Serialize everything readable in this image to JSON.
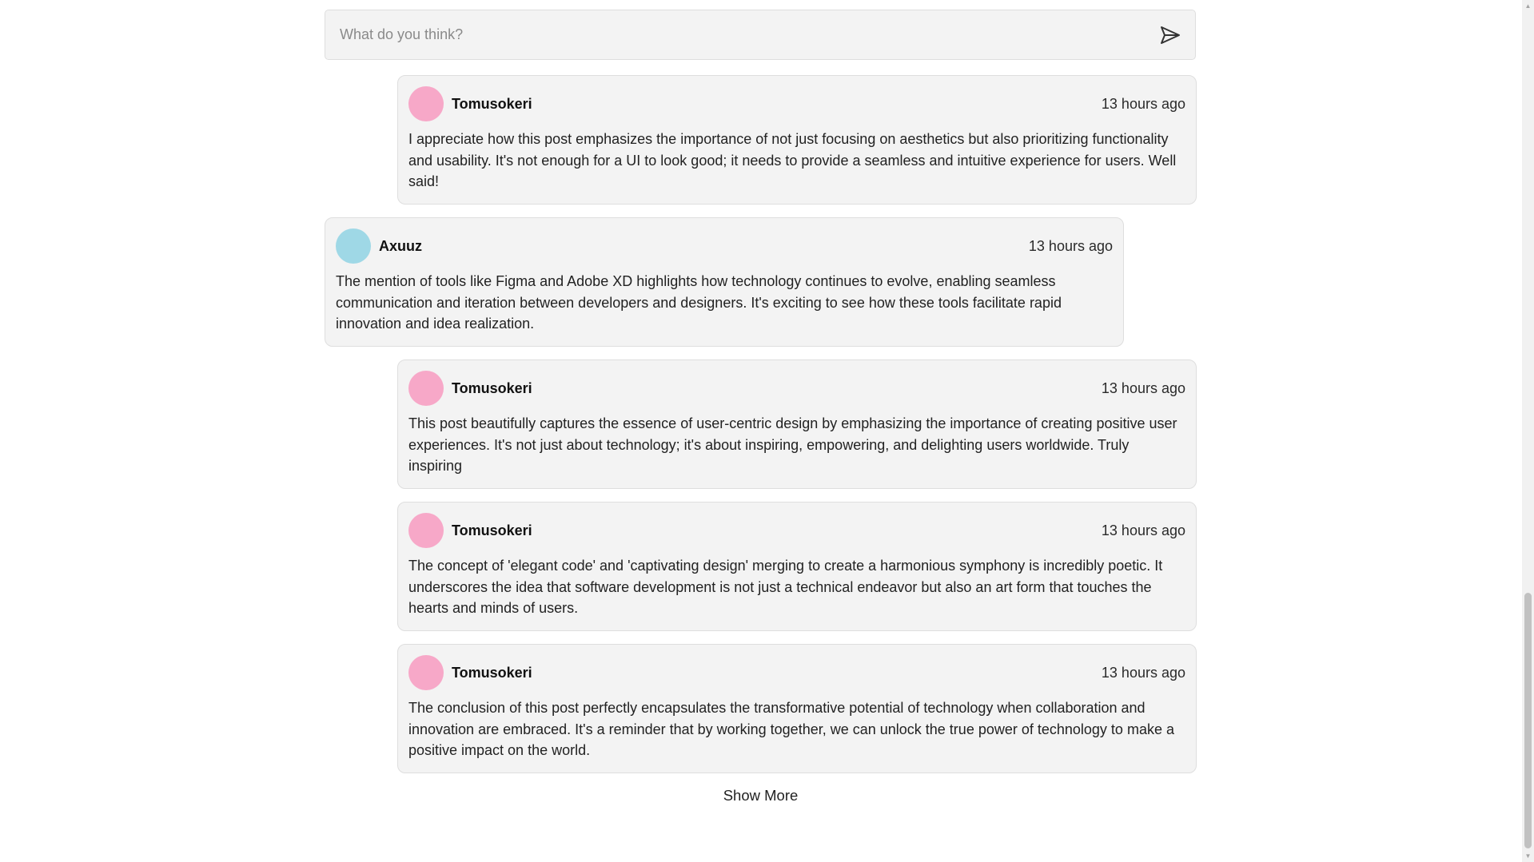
{
  "comment_box": {
    "placeholder": "What do you think?",
    "send_icon": "send-icon"
  },
  "comments": [
    {
      "author": "Tomusokeri",
      "time": "13 hours ago",
      "avatar_color": "#f7a8c8",
      "text": "I appreciate how this post emphasizes the importance of not just focusing on aesthetics but also prioritizing functionality and usability. It's not enough for a UI to look good; it needs to provide a seamless and intuitive experience for users. Well said!"
    },
    {
      "author": "Axuuz",
      "time": "13 hours ago",
      "avatar_color": "#9fd8e6",
      "text": "The mention of tools like Figma and Adobe XD highlights how technology continues to evolve, enabling seamless communication and iteration between developers and designers. It's exciting to see how these tools facilitate rapid innovation and idea realization."
    },
    {
      "author": "Tomusokeri",
      "time": "13 hours ago",
      "avatar_color": "#f7a8c8",
      "text": "This post beautifully captures the essence of user-centric design by emphasizing the importance of creating positive user experiences. It's not just about technology; it's about inspiring, empowering, and delighting users worldwide. Truly inspiring"
    },
    {
      "author": "Tomusokeri",
      "time": "13 hours ago",
      "avatar_color": "#f7a8c8",
      "text": "The concept of 'elegant code' and 'captivating design' merging to create a harmonious symphony is incredibly poetic. It underscores the idea that software development is not just a technical endeavor but also an art form that touches the hearts and minds of users."
    },
    {
      "author": "Tomusokeri",
      "time": "13 hours ago",
      "avatar_color": "#f7a8c8",
      "text": "The conclusion of this post perfectly encapsulates the transformative potential of technology when collaboration and innovation are embraced. It's a reminder that by working together, we can unlock the true power of technology to make a positive impact on the world."
    }
  ],
  "show_more_label": "Show More"
}
